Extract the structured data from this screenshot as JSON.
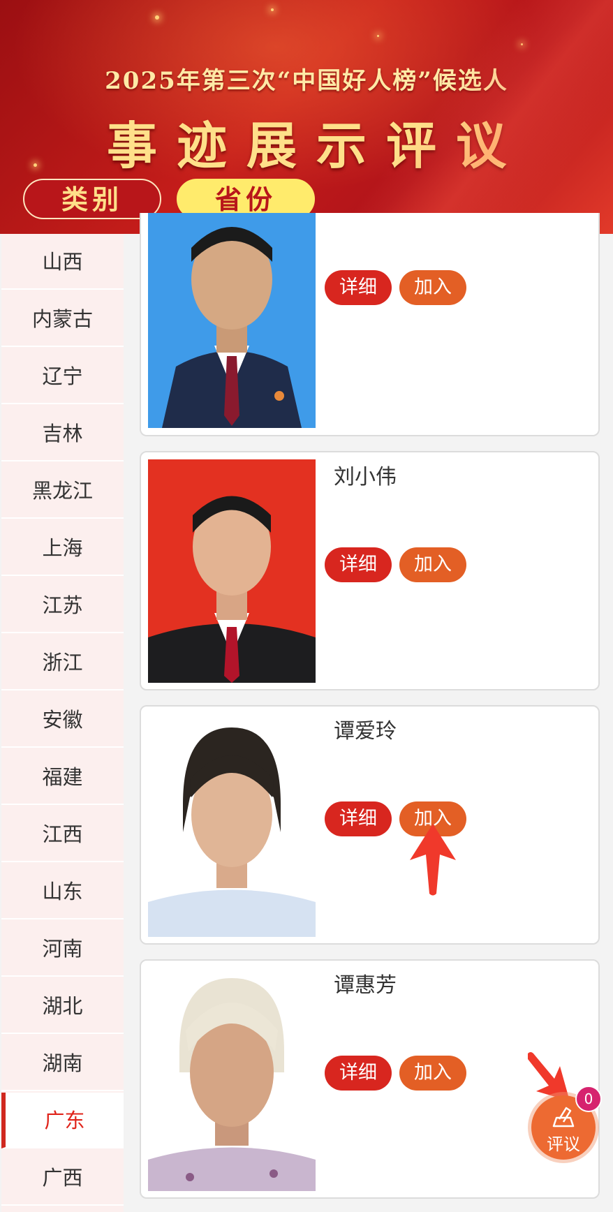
{
  "header": {
    "subtitle": "2025年第三次“中国好人榜”候选人",
    "title": "事迹展示评议",
    "tabs": [
      {
        "label": "类别"
      },
      {
        "label": "省份"
      }
    ]
  },
  "sidebar": {
    "items": [
      {
        "label": "山西"
      },
      {
        "label": "内蒙古"
      },
      {
        "label": "辽宁"
      },
      {
        "label": "吉林"
      },
      {
        "label": "黑龙江"
      },
      {
        "label": "上海"
      },
      {
        "label": "江苏"
      },
      {
        "label": "浙江"
      },
      {
        "label": "安徽"
      },
      {
        "label": "福建"
      },
      {
        "label": "江西"
      },
      {
        "label": "山东"
      },
      {
        "label": "河南"
      },
      {
        "label": "湖北"
      },
      {
        "label": "湖南"
      },
      {
        "label": "广东"
      },
      {
        "label": "广西"
      }
    ],
    "active": "广东"
  },
  "candidates": [
    {
      "name": "",
      "detail_label": "详细",
      "join_label": "加入"
    },
    {
      "name": "刘小伟",
      "detail_label": "详细",
      "join_label": "加入"
    },
    {
      "name": "谭爱玲",
      "detail_label": "详细",
      "join_label": "加入"
    },
    {
      "name": "谭惠芳",
      "detail_label": "详细",
      "join_label": "加入"
    }
  ],
  "review_button": {
    "label": "评议",
    "count": "0"
  },
  "colors": {
    "primary_red": "#d8261f",
    "join_orange": "#e35f25",
    "active_text": "#e0241b",
    "badge_pink": "#d6236e"
  }
}
